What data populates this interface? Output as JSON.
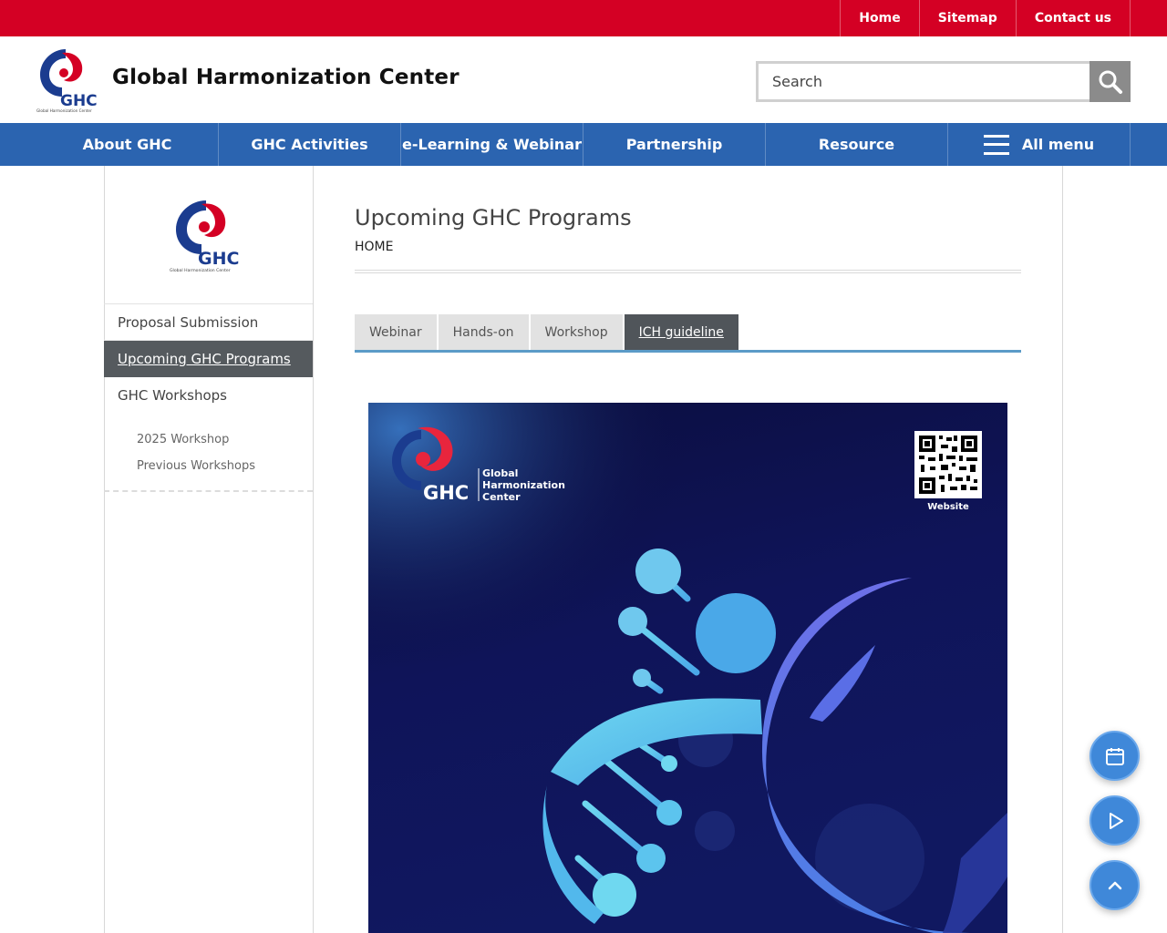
{
  "top_links": [
    "Home",
    "Sitemap",
    "Contact us"
  ],
  "site": {
    "title": "Global Harmonization Center",
    "logo_text": "GHC",
    "logo_subtext": "Global Harmonization Center"
  },
  "search": {
    "placeholder": "Search"
  },
  "nav": {
    "items": [
      "About GHC",
      "GHC Activities",
      "e-Learning & Webinar",
      "Partnership",
      "Resource"
    ],
    "all_menu": "All menu"
  },
  "sidebar": {
    "items": [
      "Proposal Submission",
      "Upcoming GHC Programs",
      "GHC Workshops"
    ],
    "active_index": 1,
    "sub_items": [
      "2025 Workshop",
      "Previous Workshops"
    ]
  },
  "main": {
    "title": "Upcoming GHC Programs",
    "breadcrumb": "HOME",
    "tabs": [
      "Webinar",
      "Hands-on",
      "Workshop",
      "ICH guideline"
    ],
    "active_tab": 3
  },
  "poster": {
    "brand_line1": "Global",
    "brand_line2": "Harmonization",
    "brand_line3": "Center",
    "brand_mark": "GHC",
    "qr_caption": "Website"
  },
  "colors": {
    "top_red": "#d40024",
    "nav_blue": "#2b64b0",
    "poster_navy": "#0d1150",
    "fab_blue": "#3f88d9"
  },
  "fab": [
    "calendar-icon",
    "play-icon",
    "chevron-up-icon"
  ]
}
